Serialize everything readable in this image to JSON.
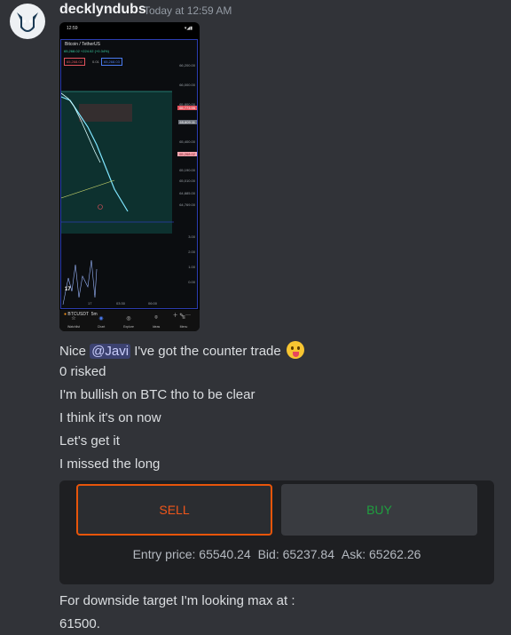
{
  "author": "decklyndubs",
  "timestamp": "Today at 12:59 AM",
  "screenshot": {
    "status_time": "12:59",
    "pair": "Bitcoin / TetherUS",
    "ohlc": "65,268.02 +224.02 (+0.34%)",
    "bid_box": "65,268.02",
    "spread_box": "0.01",
    "ask_box": "65,268.03",
    "price_scale": [
      "66,200.00",
      "66,000.00",
      "65,800.00",
      "65,600.00",
      "65,400.00",
      "65,190.00",
      "65,010.00",
      "64,885.00",
      "64,769.00"
    ],
    "tags": {
      "red_top": "65,773.95",
      "grey": "65,609.11",
      "red_low": "65,268.02"
    },
    "indicator_scale": [
      "3.00",
      "2.00",
      "1.00",
      "0.00"
    ],
    "time_labels": [
      "17",
      "03:30",
      "06:00"
    ],
    "symbol": "BTCUSDT",
    "interval": "5m",
    "nav": [
      "Watchlist",
      "Chart",
      "Explore",
      "Ideas",
      "Menu"
    ],
    "tv_logo": "17"
  },
  "messages": [
    {
      "prefix": "Nice ",
      "mention": "@Javi",
      "suffix": " I've got the counter trade"
    },
    "0 risked",
    "I'm bullish on BTC tho to be clear",
    "I think it's on now",
    "Let's get it",
    "I missed the long"
  ],
  "trade": {
    "sell_label": "SELL",
    "buy_label": "BUY",
    "entry": "Entry price: 65540.24",
    "bid": "Bid: 65237.84",
    "ask": "Ask: 65262.26",
    "colors": {
      "sell": "#f0561a",
      "buy": "#1f9f3f"
    }
  },
  "followups": [
    "For downside target I'm looking max at :",
    "61500."
  ]
}
